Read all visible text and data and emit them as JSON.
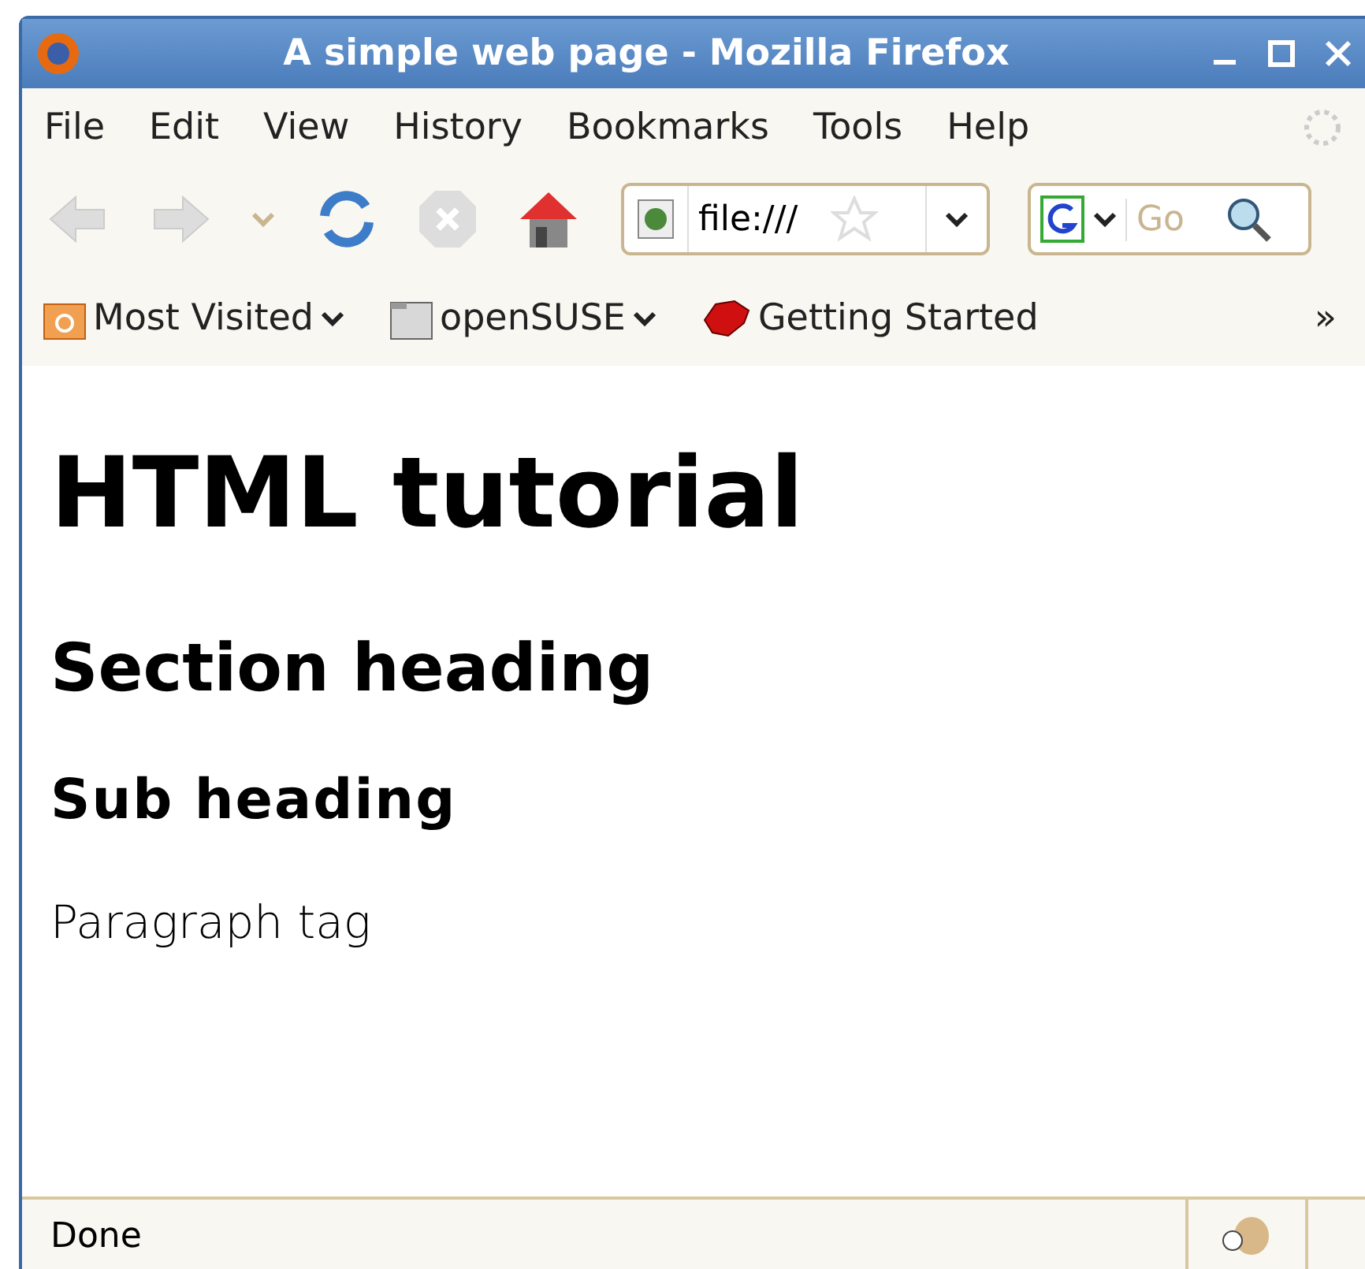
{
  "window": {
    "title": "A simple web page - Mozilla Firefox"
  },
  "menu": [
    "File",
    "Edit",
    "View",
    "History",
    "Bookmarks",
    "Tools",
    "Help"
  ],
  "address": {
    "value": "file:///"
  },
  "search": {
    "placeholder": "Go"
  },
  "bookmarks": [
    {
      "label": "Most Visited",
      "kind": "folder-menu"
    },
    {
      "label": "openSUSE",
      "kind": "plain-menu"
    },
    {
      "label": "Getting Started",
      "kind": "link"
    }
  ],
  "overflow": "»",
  "page": {
    "h1": "HTML tutorial",
    "h2": "Section heading",
    "h3": "Sub heading",
    "p": "Paragraph tag"
  },
  "status_bar": "Done"
}
